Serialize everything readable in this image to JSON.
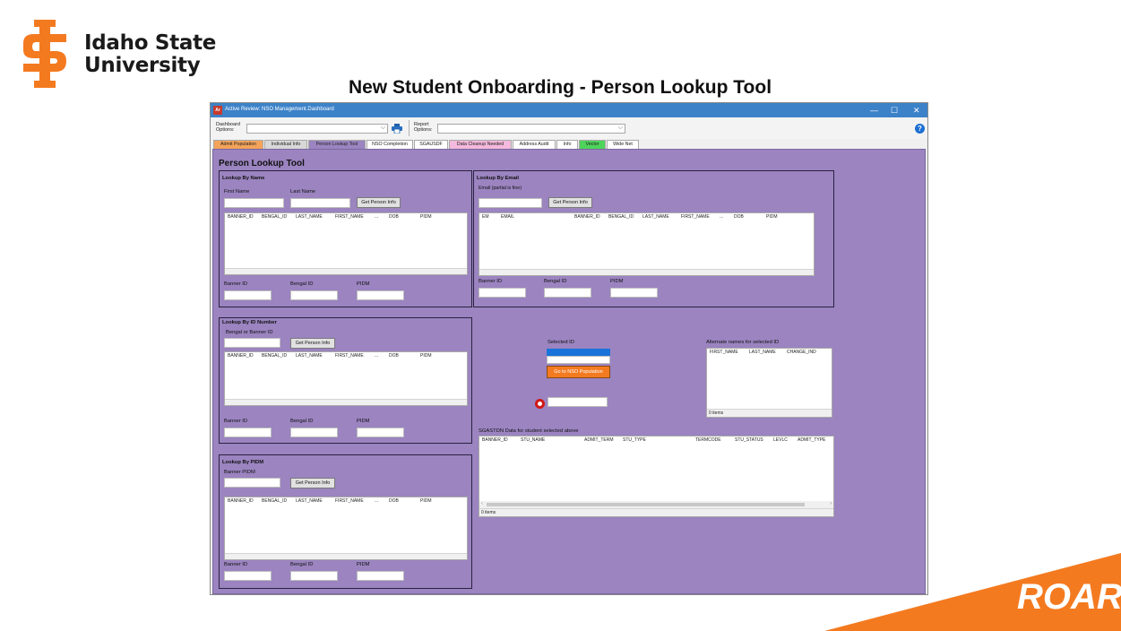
{
  "logo": {
    "line1": "Idaho State",
    "line2": "University",
    "color": "#f47a20"
  },
  "slide_title": "New Student Onboarding - Person Lookup Tool",
  "roar": "ROAR",
  "window": {
    "app_icon": "Ar",
    "title": "Active Review: NSO Management.Dashboard",
    "controls": {
      "minimize": "—",
      "maximize": "☐",
      "close": "✕"
    }
  },
  "toolbar": {
    "dashboard_label": "Dashboard Options:",
    "report_label": "Report Options:",
    "dashboard_value": "",
    "report_value": "",
    "print_icon": "printer-icon",
    "help": "?"
  },
  "tabs": [
    {
      "label": "Admit Population",
      "color": "#f4a35a"
    },
    {
      "label": "Individual Info",
      "color": "#d8d8d8"
    },
    {
      "label": "Person Lookup Tool",
      "color": "#9b84c0"
    },
    {
      "label": "NSO Completion",
      "color": "#ffffff"
    },
    {
      "label": "SGAUSDF",
      "color": "#ffffff"
    },
    {
      "label": "Data Cleanup Needed",
      "color": "#f4b9dc"
    },
    {
      "label": "Address Audit",
      "color": "#ffffff"
    },
    {
      "label": "Info",
      "color": "#ffffff"
    },
    {
      "label": "Vector",
      "color": "#4ed45b"
    },
    {
      "label": "Wide Net",
      "color": "#ffffff"
    }
  ],
  "content_title": "Person Lookup Tool",
  "by_name": {
    "title": "Lookup By Name",
    "first_label": "First Name",
    "last_label": "Last Name",
    "button": "Get Person Info",
    "columns": [
      "BANNER_ID",
      "BENGAL_ID",
      "LAST_NAME",
      "FIRST_NAME",
      "...",
      "DOB",
      "PIDM"
    ],
    "banner_label": "Banner ID",
    "bengal_label": "Bengal ID",
    "pidm_label": "PIDM"
  },
  "by_email": {
    "title": "Lookup By Email",
    "email_label": "Email (partial is fine)",
    "button": "Get Person Info",
    "columns": [
      "EM",
      "EMAIL",
      "BANNER_ID",
      "BENGAL_ID",
      "LAST_NAME",
      "FIRST_NAME",
      "...",
      "DOB",
      "PIDM"
    ],
    "banner_label": "Banner ID",
    "bengal_label": "Bengal ID",
    "pidm_label": "PIDM"
  },
  "by_id": {
    "title": "Lookup By ID Number",
    "id_label": "Bengal or Banner ID",
    "button": "Get Person Info",
    "columns": [
      "BANNER_ID",
      "BENGAL_ID",
      "LAST_NAME",
      "FIRST_NAME",
      "...",
      "DOB",
      "PIDM"
    ],
    "banner_label": "Banner ID",
    "bengal_label": "Bengal ID",
    "pidm_label": "PIDM"
  },
  "by_pidm": {
    "title": "Lookup By PIDM",
    "pidm_input_label": "Banner PIDM",
    "button": "Get Person Info",
    "columns": [
      "BANNER_ID",
      "BENGAL_ID",
      "LAST_NAME",
      "FIRST_NAME",
      "...",
      "DOB",
      "PIDM"
    ],
    "banner_label": "Banner ID",
    "bengal_label": "Bengal ID",
    "pidm_label": "PIDM"
  },
  "selected": {
    "label": "Selected ID",
    "value": "",
    "go_button": "Go to NSO Population"
  },
  "alternate": {
    "title": "Alternate names for selected ID",
    "columns": [
      "FIRST_NAME",
      "LAST_NAME",
      "CHANGE_IND"
    ],
    "status": "0 items"
  },
  "sgastdn": {
    "title": "SGASTDN Data for student selected above",
    "columns": [
      "BANNER_ID",
      "STU_NAME",
      "ADMIT_TERM",
      "STU_TYPE",
      "TERMCODE",
      "STU_STATUS",
      "LEVLC",
      "ADMIT_TYPE"
    ],
    "status": "0 items"
  }
}
